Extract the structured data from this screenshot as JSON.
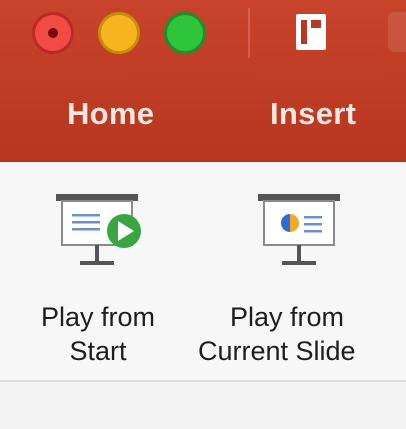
{
  "window_controls": {
    "close": "close-button",
    "minimize": "minimize-button",
    "maximize": "maximize-button"
  },
  "toolbar": {
    "sidebar_icon": "sidebar-toggle-icon"
  },
  "tabs": [
    {
      "label": "Home"
    },
    {
      "label": "Insert"
    }
  ],
  "ribbon": {
    "play_from_start": {
      "line1": "Play from",
      "line2": "Start",
      "icon": "play-from-start-icon"
    },
    "play_from_current": {
      "line1": "Play from",
      "line2": "Current Slide",
      "icon": "play-from-current-slide-icon"
    }
  },
  "colors": {
    "title_bar": "#b93a22",
    "tab_text": "#f9e7e2",
    "play_green": "#3aa642",
    "chart_blue": "#2d6fd0",
    "chart_orange": "#f4a62a"
  }
}
